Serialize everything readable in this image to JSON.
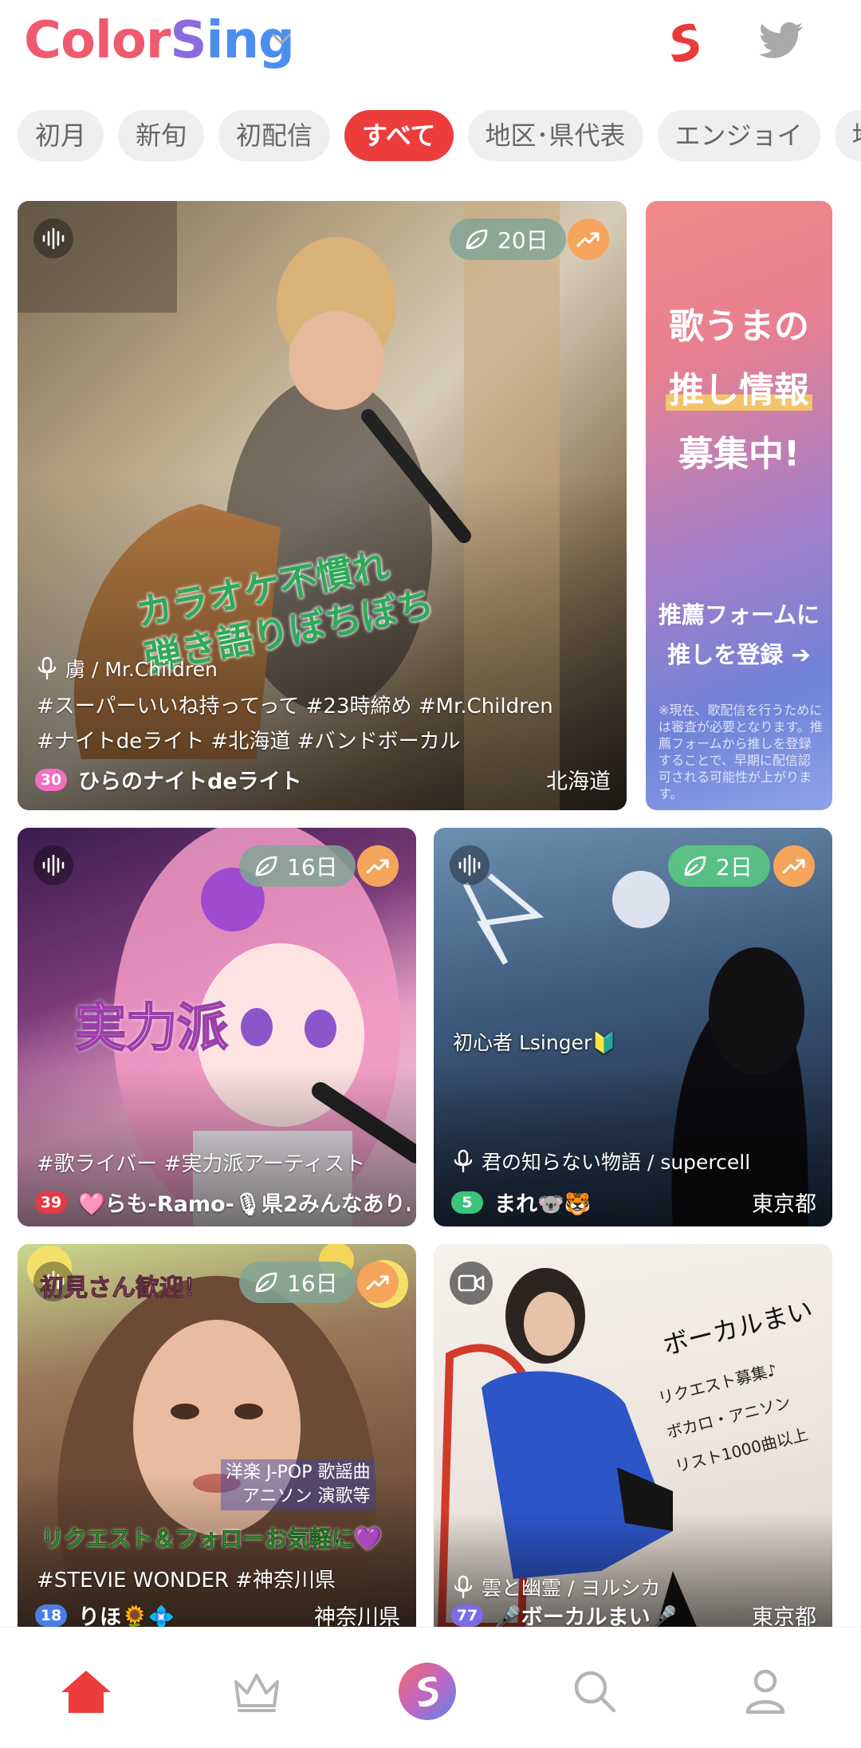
{
  "header": {
    "logo_part1": "Color",
    "logo_part2": "S",
    "logo_part3": "ing"
  },
  "tabs": [
    {
      "label": "初月"
    },
    {
      "label": "新旬"
    },
    {
      "label": "初配信"
    },
    {
      "label": "すべて",
      "active": true
    },
    {
      "label": "地区･県代表"
    },
    {
      "label": "エンジョイ"
    },
    {
      "label": "地"
    }
  ],
  "cards": [
    {
      "days": "20日",
      "caption": "カラオケ不慣れ\n弾き語りぼちぼち",
      "song": "虜 / Mr.Children",
      "tags_line1": "#スーパーいいね持ってって #23時締め #Mr.Children",
      "tags_line2": "#ナイトdeライト #北海道 #バンドボーカル",
      "level": "30",
      "user": "ひらのナイトdeライト",
      "region": "北海道"
    },
    {
      "days": "16日",
      "caption": "実力派",
      "tags": "#歌ライバー #実力派アーティスト",
      "level": "39",
      "user": "🩷らも-Ramo-🎙県2みんなあり…",
      "region": ""
    },
    {
      "days": "2日",
      "caption": "初心者 Lsinger🔰",
      "song": "君の知らない物語 / supercell",
      "level": "5",
      "user": "まれ🐨🐯",
      "region": "東京都"
    },
    {
      "days": "16日",
      "caption": "初見さん歓迎！",
      "caption2": "洋楽 J-POP 歌謡曲\nアニソン 演歌等",
      "caption3": "リクエスト＆フォローお気軽に💜",
      "tags": "#STEVIE WONDER #神奈川県",
      "level": "18",
      "user": "りほ🌻💠",
      "region": "神奈川県"
    },
    {
      "caption": "ボーカルまい",
      "caption2": "リクエスト募集♪\nボカロ・アニソン\nリスト1000曲以上",
      "song": "雲と幽霊 / ヨルシカ",
      "level": "77",
      "user": "🎤ボーカルまい🎤",
      "region": "東京都"
    }
  ],
  "promo": {
    "line1": "歌うまの",
    "line2": "推し情報",
    "line3": "募集中!",
    "cta1": "推薦フォームに",
    "cta2": "推しを登録 ➔",
    "note": "※現在、歌配信を行うためには審査が必要となります。推薦フォームから推しを登録することで、早期に配信認可される可能性が上がります。"
  },
  "colors": {
    "accent": "#ec3c3c",
    "trend": "#f4a55b",
    "level_pink": "#f06fc0",
    "level_red": "#e53945",
    "level_green": "#3cc47a",
    "level_blue": "#4a7ee6",
    "level_purple": "#7a6ce6"
  },
  "icons": {
    "nav": [
      "home-icon",
      "crown-icon",
      "colorsing-icon",
      "search-icon",
      "profile-icon"
    ]
  }
}
